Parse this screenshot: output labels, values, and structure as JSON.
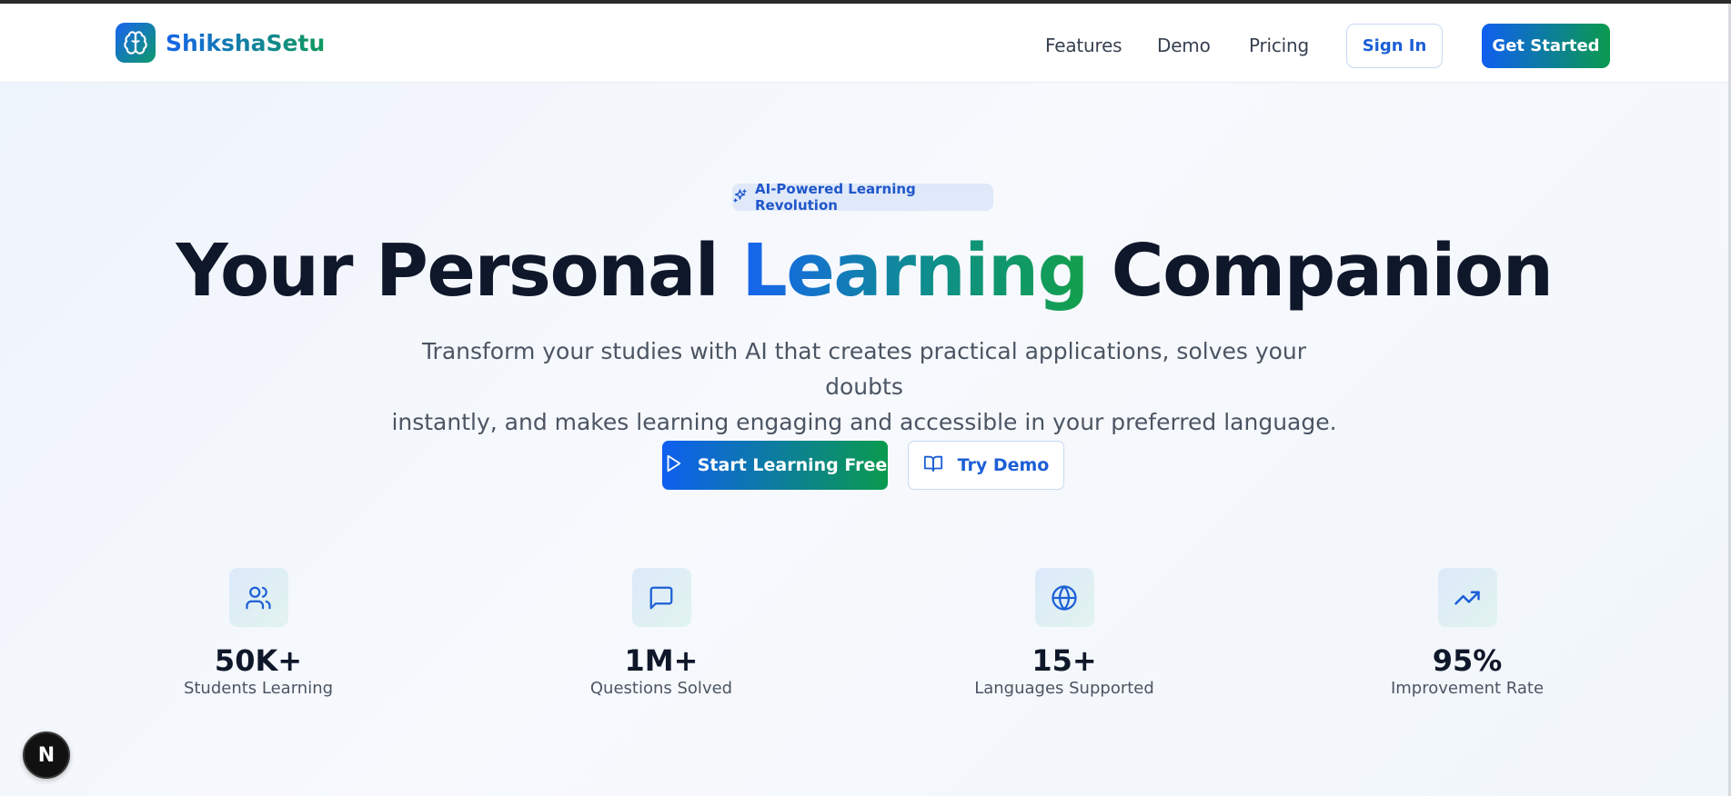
{
  "brand": {
    "name": "ShikshaSetu",
    "logo_icon": "brain-icon"
  },
  "nav": {
    "links": [
      "Features",
      "Demo",
      "Pricing"
    ],
    "sign_in": "Sign In",
    "get_started": "Get Started"
  },
  "hero": {
    "badge": "AI-Powered Learning Revolution",
    "title_pre": "Your Personal ",
    "title_highlight": "Learning",
    "title_post": " Companion",
    "subtitle_line1": "Transform your studies with AI that creates practical applications, solves your doubts",
    "subtitle_line2": "instantly, and makes learning engaging and accessible in your preferred language.",
    "primary_cta": "Start Learning Free",
    "secondary_cta": "Try Demo"
  },
  "stats": [
    {
      "icon": "users-icon",
      "value": "50K+",
      "label": "Students Learning"
    },
    {
      "icon": "message-square-icon",
      "value": "1M+",
      "label": "Questions Solved"
    },
    {
      "icon": "globe-icon",
      "value": "15+",
      "label": "Languages Supported"
    },
    {
      "icon": "trending-up-icon",
      "value": "95%",
      "label": "Improvement Rate"
    }
  ],
  "dev_badge": {
    "letter": "N"
  },
  "colors": {
    "primary_blue": "#1565e8",
    "primary_green": "#0f9a5d",
    "text_dark": "#0f172a",
    "text_muted": "#4b5563"
  }
}
